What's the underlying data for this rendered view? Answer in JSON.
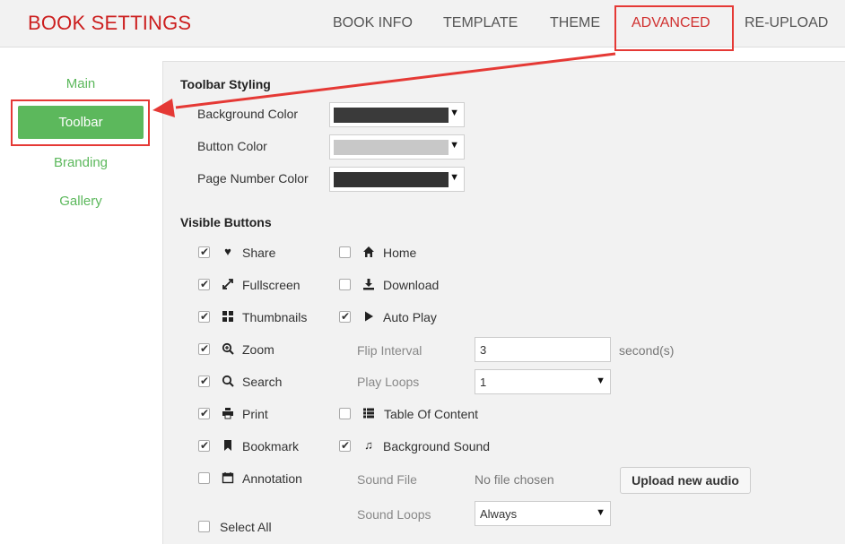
{
  "header": {
    "title": "BOOK SETTINGS",
    "tabs": [
      {
        "label": "BOOK INFO"
      },
      {
        "label": "TEMPLATE"
      },
      {
        "label": "THEME"
      },
      {
        "label": "ADVANCED",
        "active": true
      },
      {
        "label": "RE-UPLOAD"
      }
    ]
  },
  "sidebar": {
    "items": [
      {
        "label": "Main"
      },
      {
        "label": "Toolbar",
        "active": true
      },
      {
        "label": "Branding"
      },
      {
        "label": "Gallery"
      }
    ]
  },
  "toolbar_styling": {
    "title": "Toolbar Styling",
    "rows": [
      {
        "label": "Background Color",
        "color": "#3a3a3a"
      },
      {
        "label": "Button Color",
        "color": "#c8c8c8"
      },
      {
        "label": "Page Number Color",
        "color": "#333333"
      }
    ]
  },
  "visible_buttons": {
    "title": "Visible Buttons",
    "left": [
      {
        "label": "Share",
        "icon": "heart-icon",
        "checked": true
      },
      {
        "label": "Fullscreen",
        "icon": "expand-icon",
        "checked": true
      },
      {
        "label": "Thumbnails",
        "icon": "thumbnails-icon",
        "checked": true
      },
      {
        "label": "Zoom",
        "icon": "zoom-icon",
        "checked": true
      },
      {
        "label": "Search",
        "icon": "search-icon",
        "checked": true
      },
      {
        "label": "Print",
        "icon": "print-icon",
        "checked": true
      },
      {
        "label": "Bookmark",
        "icon": "bookmark-icon",
        "checked": true
      },
      {
        "label": "Annotation",
        "icon": "calendar-icon",
        "checked": false
      }
    ],
    "right": {
      "home": {
        "label": "Home",
        "icon": "home-icon",
        "checked": false
      },
      "download": {
        "label": "Download",
        "icon": "download-icon",
        "checked": false
      },
      "autoplay": {
        "label": "Auto Play",
        "icon": "play-icon",
        "checked": true
      },
      "flip_interval": {
        "label": "Flip Interval",
        "value": "3",
        "unit": "second(s)"
      },
      "play_loops": {
        "label": "Play Loops",
        "value": "1"
      },
      "toc": {
        "label": "Table Of Content",
        "icon": "list-icon",
        "checked": false
      },
      "bg_sound": {
        "label": "Background Sound",
        "icon": "music-icon",
        "checked": true
      },
      "sound_file": {
        "label": "Sound File",
        "status": "No file chosen",
        "button": "Upload new audio"
      },
      "sound_loops": {
        "label": "Sound Loops",
        "value": "Always"
      }
    },
    "select_all": {
      "label": "Select All",
      "checked": false
    }
  },
  "colors": {
    "brand_red": "#cc1f1f",
    "accent_green": "#5cb85c",
    "highlight_red": "#e53935"
  }
}
